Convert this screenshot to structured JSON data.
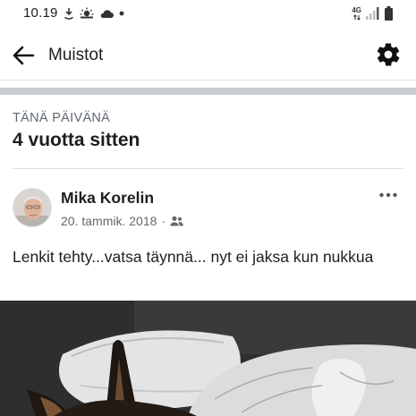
{
  "status_bar": {
    "time": "10.19",
    "network": "4G",
    "icons": [
      "download-icon",
      "weather-sunrise-icon",
      "cloud-icon",
      "dot-icon",
      "network-4g-icon",
      "signal-icon",
      "battery-icon"
    ]
  },
  "app_bar": {
    "title": "Muistot",
    "back_icon": "arrow-left-icon",
    "settings_icon": "gear-icon"
  },
  "memory": {
    "section_label": "TÄNÄ PÄIVÄNÄ",
    "years_ago": "4 vuotta sitten"
  },
  "post": {
    "author": "Mika Korelin",
    "date": "20. tammik. 2018",
    "separator": "·",
    "audience_icon": "friends-icon",
    "text": "Lenkit tehty...vatsa täynnä... nyt ei jaksa kun nukkua",
    "more_icon": "more-horizontal-icon"
  },
  "colors": {
    "divider_band": "#c9ccd1",
    "secondary_text": "#65676b",
    "primary_text": "#1c1e21"
  }
}
